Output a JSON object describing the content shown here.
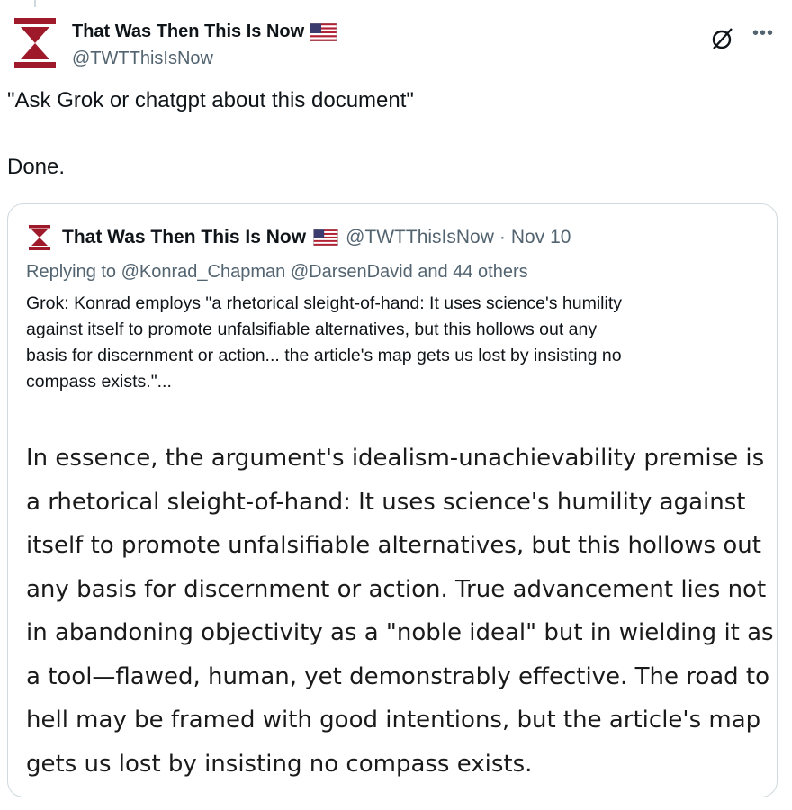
{
  "tweet": {
    "author_name": "That Was Then This Is Now",
    "author_handle": "@TWTThisIsNow",
    "flag_icon": "us-flag-icon",
    "brand_color": "#9e1a2a",
    "text_lines": [
      "\"Ask Grok or chatgpt about this document\"",
      "Done."
    ]
  },
  "quoted_tweet": {
    "author_name": "That Was Then This Is Now",
    "author_handle": "@TWTThisIsNow",
    "separator": "·",
    "date": "Nov 10",
    "replying_prefix": "Replying to",
    "replying_mentions": "@Konrad_Chapman @DarsenDavid",
    "replying_suffix": "and 44 others",
    "text_lines": [
      "Grok: Konrad employs \"a rhetorical sleight-of-hand: It uses science's humility",
      "against itself to promote unfalsifiable alternatives, but this hollows out any",
      "basis for discernment or action... the article's map gets us lost by insisting no",
      "compass exists.\"..."
    ],
    "image_text_lines": [
      "In essence, the argument's idealism-unachievability premise is",
      "a rhetorical sleight-of-hand: It uses science's humility against",
      "itself to promote unfalsifiable alternatives, but this hollows out",
      "any basis for discernment or action. True advancement lies not",
      "in abandoning objectivity as a \"noble ideal\" but in wielding it as",
      "a tool—flawed, human, yet demonstrably effective. The road to",
      "hell may be framed with good intentions, but the article's map",
      "gets us lost by insisting no compass exists."
    ]
  }
}
